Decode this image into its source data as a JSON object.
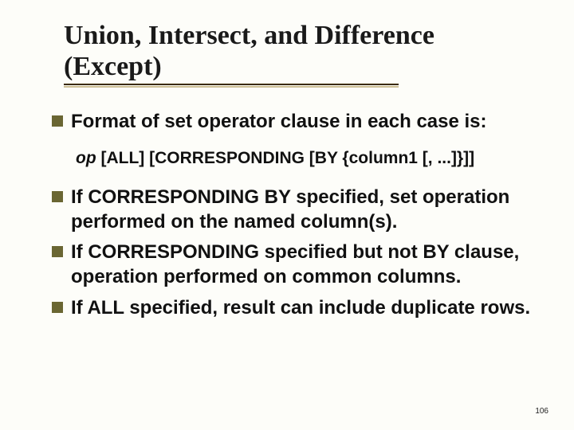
{
  "title_line1": "Union, Intersect, and Difference",
  "title_line2": "(Except)",
  "bullets": {
    "b0": "Format of set operator clause in each case is:",
    "b1": "If CORRESPONDING BY specified, set operation performed on the named column(s).",
    "b2": "If CORRESPONDING specified but not BY clause, operation performed on common columns.",
    "b3": "If ALL specified, result can include duplicate rows."
  },
  "syntax": {
    "op": "op",
    "rest": " [ALL] [CORRESPONDING [BY {column1 [, ...]}]]"
  },
  "page_number": "106"
}
